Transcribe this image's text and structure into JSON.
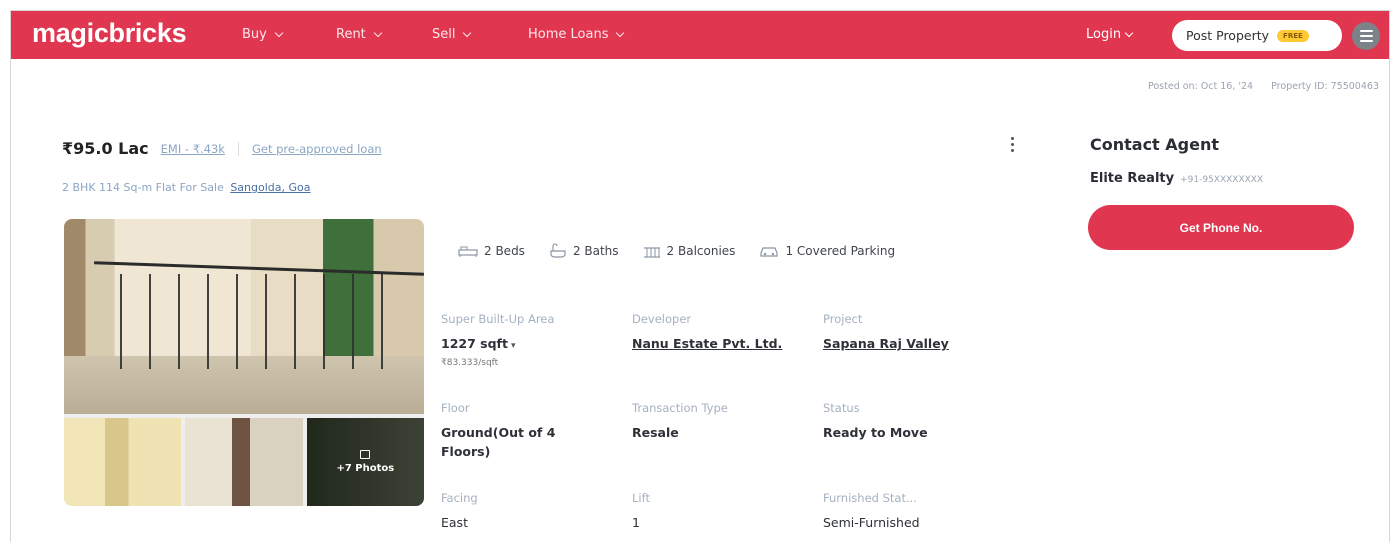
{
  "header": {
    "logo": "magicbricks",
    "nav": [
      {
        "label": "Buy"
      },
      {
        "label": "Rent"
      },
      {
        "label": "Sell"
      },
      {
        "label": "Home Loans"
      }
    ],
    "login_label": "Login",
    "post_property_label": "Post Property",
    "free_badge": "FREE",
    "brand_color": "#e0364f"
  },
  "meta": {
    "posted_on": "Posted on: Oct 16, '24",
    "property_id": "Property ID: 75500463"
  },
  "listing": {
    "price": "₹95.0 Lac",
    "emi": "EMI - ₹.43k",
    "loan_link": "Get pre-approved loan",
    "subtitle": "2 BHK 114 Sq-m Flat For Sale",
    "location": "Sangolda, Goa",
    "more_photos": "+7 Photos"
  },
  "amenities": [
    {
      "icon": "bed-icon",
      "label": "2 Beds"
    },
    {
      "icon": "bath-icon",
      "label": "2 Baths"
    },
    {
      "icon": "balcony-icon",
      "label": "2 Balconies"
    },
    {
      "icon": "parking-icon",
      "label": "1 Covered Parking"
    }
  ],
  "details": {
    "area_label": "Super Built-Up Area",
    "area_value": "1227 sqft",
    "area_rate": "₹83.333/sqft",
    "developer_label": "Developer",
    "developer_value": "Nanu Estate Pvt. Ltd.",
    "project_label": "Project",
    "project_value": "Sapana Raj Valley",
    "floor_label": "Floor",
    "floor_value": "Ground(Out of 4 Floors)",
    "transaction_label": "Transaction Type",
    "transaction_value": "Resale",
    "status_label": "Status",
    "status_value": "Ready to Move",
    "facing_label": "Facing",
    "facing_value": "East",
    "lift_label": "Lift",
    "lift_value": "1",
    "furnished_label": "Furnished Stat...",
    "furnished_value": "Semi-Furnished"
  },
  "contact": {
    "title": "Contact Agent",
    "agent_name": "Elite Realty",
    "agent_phone": "+91-95XXXXXXXX",
    "button_label": "Get Phone No."
  }
}
